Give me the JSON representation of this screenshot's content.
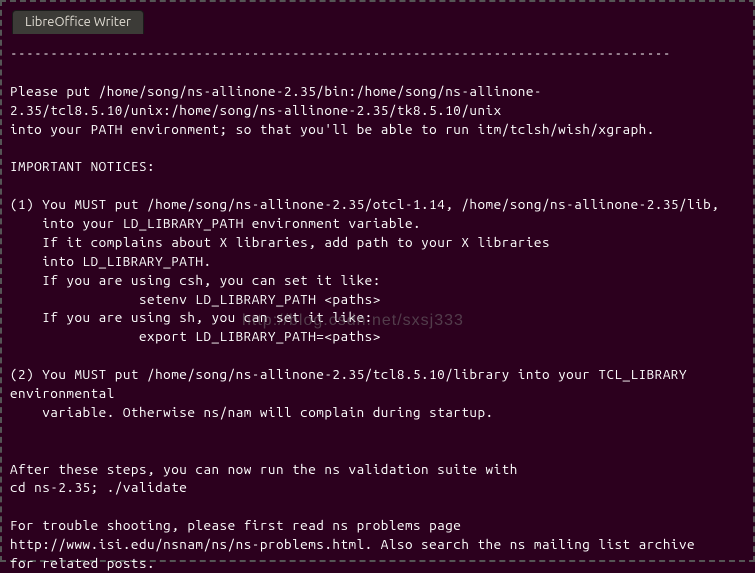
{
  "tab": {
    "label": "LibreOffice Writer"
  },
  "terminal": {
    "lines": [
      "----------------------------------------------------------------------------------",
      "",
      "Please put /home/song/ns-allinone-2.35/bin:/home/song/ns-allinone-2.35/tcl8.5.10/unix:/home/song/ns-allinone-2.35/tk8.5.10/unix",
      "into your PATH environment; so that you'll be able to run itm/tclsh/wish/xgraph.",
      "",
      "IMPORTANT NOTICES:",
      "",
      "(1) You MUST put /home/song/ns-allinone-2.35/otcl-1.14, /home/song/ns-allinone-2.35/lib,",
      "    into your LD_LIBRARY_PATH environment variable.",
      "    If it complains about X libraries, add path to your X libraries",
      "    into LD_LIBRARY_PATH.",
      "    If you are using csh, you can set it like:",
      "                setenv LD_LIBRARY_PATH <paths>",
      "    If you are using sh, you can set it like:",
      "                export LD_LIBRARY_PATH=<paths>",
      "",
      "(2) You MUST put /home/song/ns-allinone-2.35/tcl8.5.10/library into your TCL_LIBRARY environmental",
      "    variable. Otherwise ns/nam will complain during startup.",
      "",
      "",
      "After these steps, you can now run the ns validation suite with",
      "cd ns-2.35; ./validate",
      "",
      "For trouble shooting, please first read ns problems page",
      "http://www.isi.edu/nsnam/ns/ns-problems.html. Also search the ns mailing list archive",
      "for related posts.",
      ""
    ]
  },
  "watermark": "http://blog.csdn.net/sxsj333"
}
